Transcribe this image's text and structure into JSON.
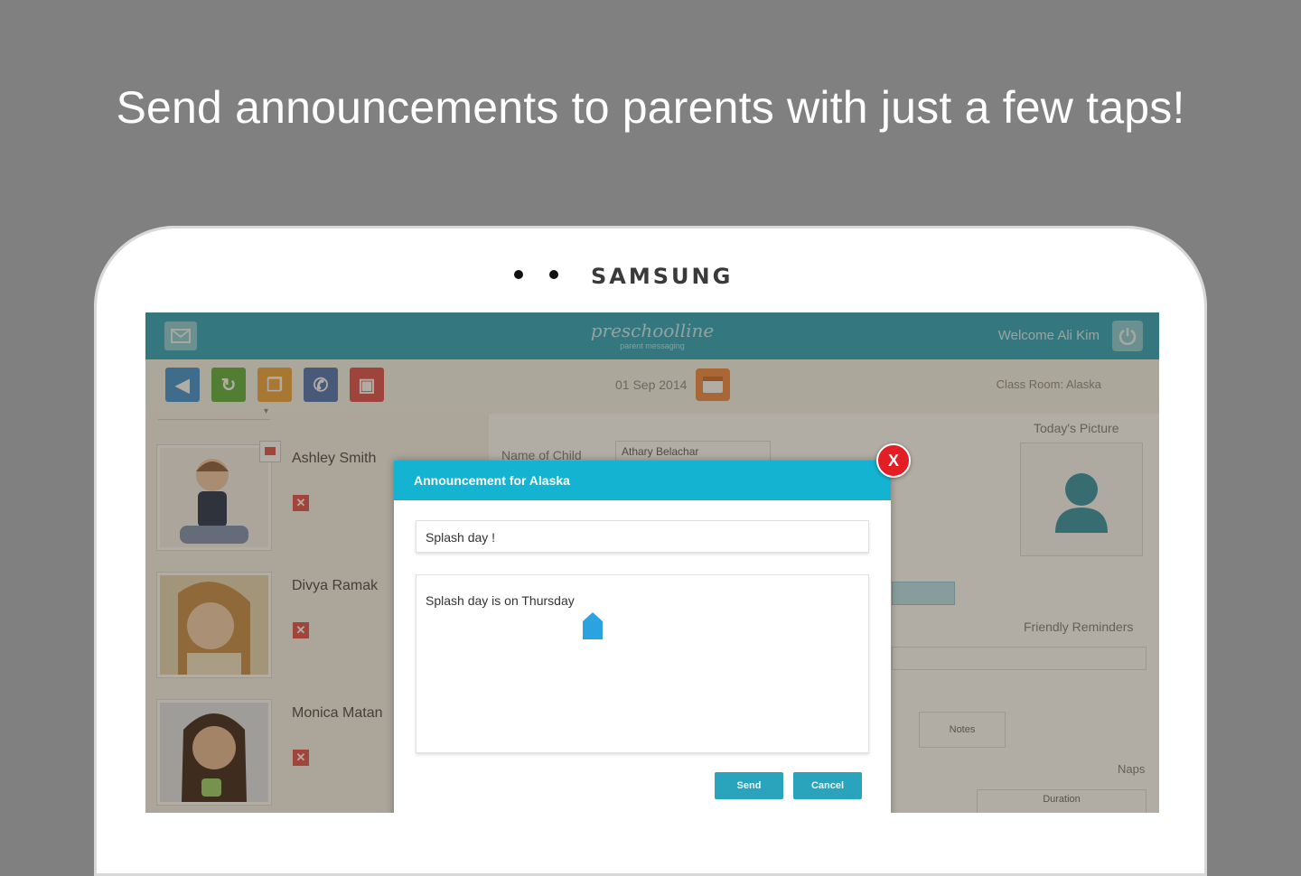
{
  "headline": "Send announcements to parents with just a few taps!",
  "device_brand": "SAMSUNG",
  "app": {
    "logo": "preschoolline",
    "logo_tagline": "parent messaging",
    "welcome": "Welcome  Ali Kim",
    "date": "01 Sep 2014",
    "classroom": "Class Room: Alaska",
    "toolbar_icons": [
      "sound-icon",
      "refresh-icon",
      "copy-icon",
      "megaphone-icon",
      "clipboard-icon"
    ],
    "dropdown": "▾",
    "students": [
      {
        "name": "Ashley Smith"
      },
      {
        "name": "Divya  Ramak"
      },
      {
        "name": "Monica Matan"
      }
    ],
    "details": {
      "name_label": "Name of Child",
      "name_value": "Athary Belachar",
      "todays_picture": "Today's Picture",
      "friendly_reminders": "Friendly Reminders",
      "notes": "Notes",
      "naps": "Naps",
      "duration": "Duration"
    },
    "colors": {
      "teal": "#2aa3bd",
      "dialog_header": "#14b3d2",
      "close": "#e31e24",
      "calendar": "#f0873d"
    }
  },
  "dialog": {
    "title": "Announcement for Alaska",
    "subject": "Splash day !",
    "message": "Splash day is on Thursday",
    "send": "Send",
    "cancel": "Cancel",
    "close": "X"
  }
}
